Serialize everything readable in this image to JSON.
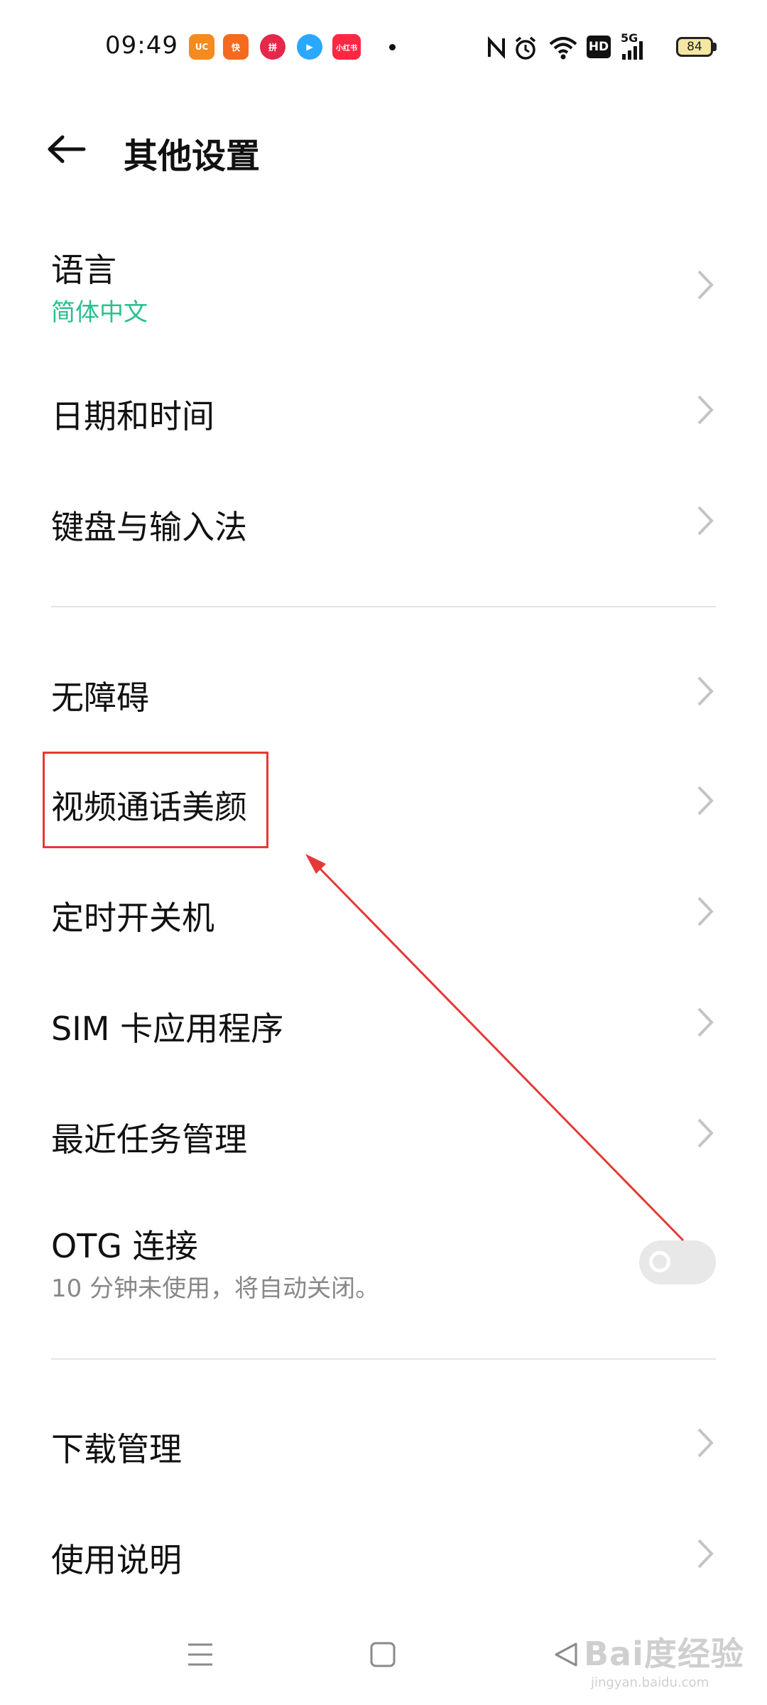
{
  "status_bar": {
    "time": "09:49",
    "apps": [
      {
        "icon": "uc-browser-icon",
        "color": "#f58a1f",
        "label": "UC"
      },
      {
        "icon": "kuaishou-icon",
        "color": "#f56a1e",
        "label": "快"
      },
      {
        "icon": "pinduoduo-icon",
        "color": "#e5274a",
        "label": "拼"
      },
      {
        "icon": "tencent-video-icon",
        "color": "#2aa7ff",
        "label": "▶"
      },
      {
        "icon": "xiaohongshu-icon",
        "color": "#ff2742",
        "label": "小红书"
      }
    ],
    "network": "5G",
    "hd_label": "HD",
    "battery": "84"
  },
  "header": {
    "title": "其他设置"
  },
  "items": {
    "language": {
      "label": "语言",
      "value": "简体中文"
    },
    "datetime": {
      "label": "日期和时间"
    },
    "keyboard": {
      "label": "键盘与输入法"
    },
    "accessibility": {
      "label": "无障碍"
    },
    "video_beauty": {
      "label": "视频通话美颜"
    },
    "scheduled_power": {
      "label": "定时开关机"
    },
    "sim_apps": {
      "label": "SIM 卡应用程序"
    },
    "recent_tasks": {
      "label": "最近任务管理"
    },
    "otg": {
      "label": "OTG 连接",
      "description": "10 分钟未使用，将自动关闭。",
      "enabled": false
    },
    "downloads": {
      "label": "下载管理"
    },
    "instructions": {
      "label": "使用说明"
    }
  },
  "watermark": {
    "text": "Bai度经验",
    "sub": "jingyan.baidu.com"
  },
  "colors": {
    "accent_green": "#2bbf8f",
    "annotation_red": "#e53935",
    "chevron": "#c4c4c4",
    "subtext": "#888888"
  }
}
